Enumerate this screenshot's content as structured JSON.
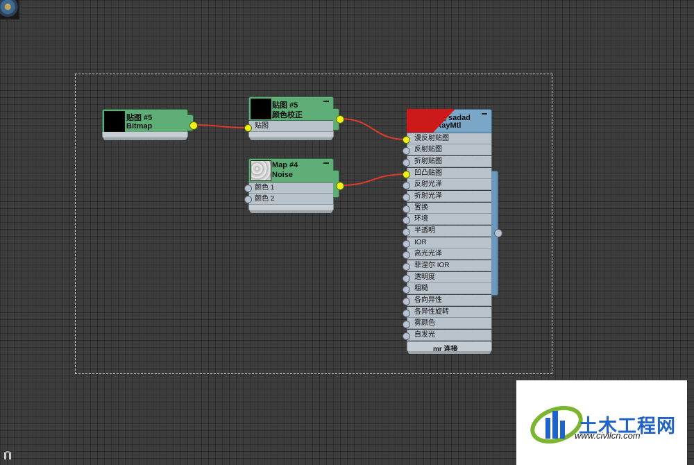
{
  "nodes": {
    "bitmap": {
      "line1": "贴图 #5",
      "line2": "Bitmap"
    },
    "color_correction": {
      "line1": "贴图 #5",
      "line2": "颜色校正",
      "slots": [
        "贴图"
      ]
    },
    "noise": {
      "line1": "Map #4",
      "line2": "Noise",
      "slots": [
        "颜色 1",
        "颜色 2"
      ]
    },
    "vray": {
      "line1": "墙面 sadad",
      "line2": "VRayMtl",
      "slots": [
        "漫反射贴图",
        "反射贴图",
        "折射贴图",
        "凹凸贴图",
        "反射光泽",
        "折射光泽",
        "置换",
        "环境",
        "半透明",
        "IOR",
        "高光光泽",
        "菲涅尔 IOR",
        "透明度",
        "粗糙",
        "各向异性",
        "各异性旋转",
        "雾颜色",
        "自发光"
      ],
      "footer": "mr 连接"
    }
  },
  "watermark": {
    "name": "土木工程网",
    "url": "www.civilcn.com"
  },
  "colors": {
    "canvas": "#3c3c3c",
    "map_node": "#5fae78",
    "material_node": "#7aa6c8",
    "wire": "#e03a2a",
    "socket_active": "#ecf21a"
  }
}
